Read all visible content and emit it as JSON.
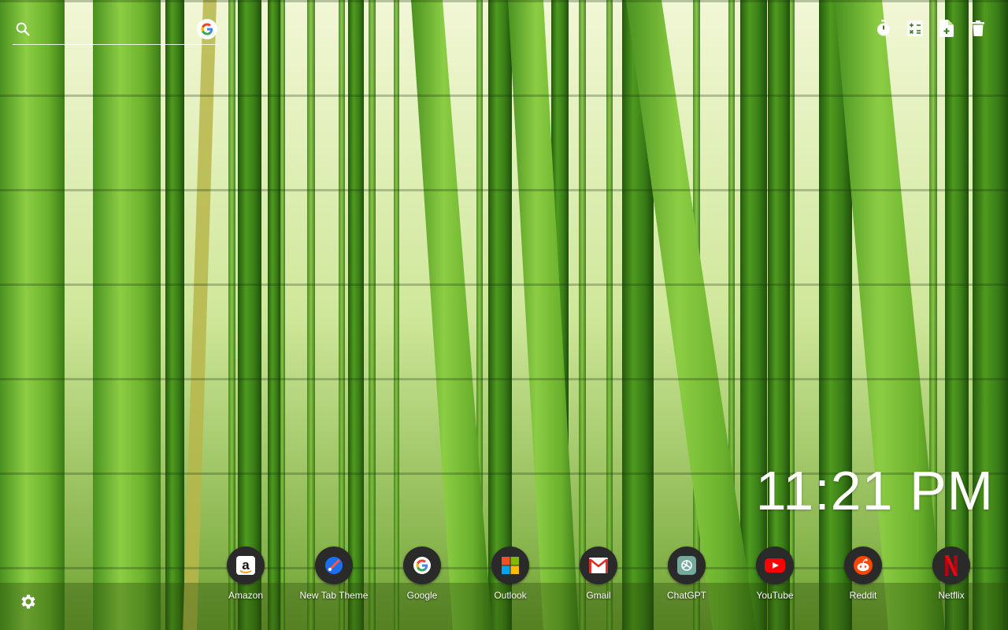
{
  "search": {
    "placeholder": "",
    "icon": "search-icon",
    "engine_icon": "google-icon"
  },
  "toolbar": {
    "items": [
      {
        "icon": "timer-icon"
      },
      {
        "icon": "calculator-icon"
      },
      {
        "icon": "add-note-icon"
      },
      {
        "icon": "trash-icon"
      }
    ]
  },
  "clock": {
    "time": "11:21 PM"
  },
  "shortcuts": [
    {
      "label": "Amazon",
      "icon": "amazon-icon"
    },
    {
      "label": "New Tab Theme",
      "icon": "new-tab-theme-icon"
    },
    {
      "label": "Google",
      "icon": "google-icon"
    },
    {
      "label": "Outlook",
      "icon": "microsoft-icon"
    },
    {
      "label": "Gmail",
      "icon": "gmail-icon"
    },
    {
      "label": "ChatGPT",
      "icon": "chatgpt-icon"
    },
    {
      "label": "YouTube",
      "icon": "youtube-icon"
    },
    {
      "label": "Reddit",
      "icon": "reddit-icon"
    },
    {
      "label": "Netflix",
      "icon": "netflix-icon"
    }
  ],
  "settings": {
    "icon": "gear-icon"
  },
  "colors": {
    "bamboo_dark": "#2f6e14",
    "bamboo_light": "#8fcf3c",
    "sky": "#f3f8d8",
    "text": "#ffffff"
  }
}
